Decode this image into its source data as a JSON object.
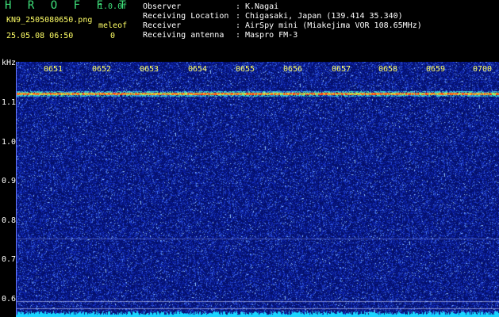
{
  "header": {
    "app_title": "H R O F F T",
    "app_version": "1.0.0f",
    "file_name": "KN9_2505080650.png",
    "datetime": "25.05.08 06:50",
    "mode_label": "meleof",
    "mode_value": "0",
    "meta": [
      {
        "key": "Observer",
        "value": "K.Nagai"
      },
      {
        "key": "Receiving Location",
        "value": "Chigasaki, Japan (139.414 35.340)"
      },
      {
        "key": "Receiver",
        "value": "AirSpy mini (Miakejima VOR 108.65MHz)"
      },
      {
        "key": "Receiving antenna",
        "value": "Maspro FM-3"
      }
    ],
    "separator": ":"
  },
  "spectrogram": {
    "unit": "kHz",
    "y_ticks": [
      "1.1",
      "1.0",
      "0.9",
      "0.8",
      "0.7",
      "0.6"
    ],
    "x_ticks": [
      "0651",
      "0652",
      "0653",
      "0654",
      "0655",
      "0656",
      "0657",
      "0658",
      "0659",
      "0700"
    ],
    "signal_freq_khz": 1.08,
    "y_range_khz": [
      0.585,
      1.15
    ],
    "background_color": "#0a1aa0",
    "signal_color": "#ff3a1a",
    "baseline_color": "#19d4ff"
  }
}
